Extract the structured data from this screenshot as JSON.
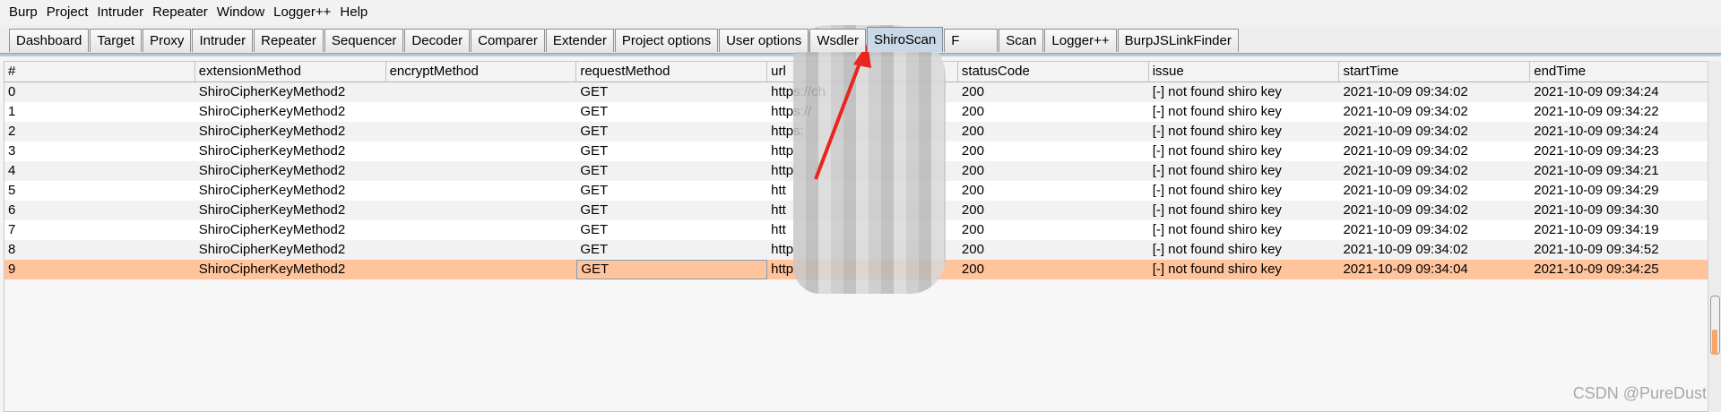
{
  "menu": [
    "Burp",
    "Project",
    "Intruder",
    "Repeater",
    "Window",
    "Logger++",
    "Help"
  ],
  "tabs": [
    "Dashboard",
    "Target",
    "Proxy",
    "Intruder",
    "Repeater",
    "Sequencer",
    "Decoder",
    "Comparer",
    "Extender",
    "Project options",
    "User options",
    "Wsdler",
    "ShiroScan",
    "F",
    "Scan",
    "Logger++",
    "BurpJSLinkFinder"
  ],
  "active_tab": "ShiroScan",
  "columns": [
    "#",
    "extensionMethod",
    "encryptMethod",
    "requestMethod",
    "url",
    "statusCode",
    "issue",
    "startTime",
    "endTime"
  ],
  "rows": [
    {
      "id": "0",
      "ext": "ShiroCipherKeyMethod2",
      "enc": "",
      "req": "GET",
      "url": "https://ch",
      "status": "200",
      "issue": "[-] not found shiro key",
      "start": "2021-10-09 09:34:02",
      "end": "2021-10-09 09:34:24"
    },
    {
      "id": "1",
      "ext": "ShiroCipherKeyMethod2",
      "enc": "",
      "req": "GET",
      "url": "https://",
      "status": "200",
      "issue": "[-] not found shiro key",
      "start": "2021-10-09 09:34:02",
      "end": "2021-10-09 09:34:22"
    },
    {
      "id": "2",
      "ext": "ShiroCipherKeyMethod2",
      "enc": "",
      "req": "GET",
      "url": "https:",
      "status": "200",
      "issue": "[-] not found shiro key",
      "start": "2021-10-09 09:34:02",
      "end": "2021-10-09 09:34:24"
    },
    {
      "id": "3",
      "ext": "ShiroCipherKeyMethod2",
      "enc": "",
      "req": "GET",
      "url": "http",
      "status": "200",
      "issue": "[-] not found shiro key",
      "start": "2021-10-09 09:34:02",
      "end": "2021-10-09 09:34:23"
    },
    {
      "id": "4",
      "ext": "ShiroCipherKeyMethod2",
      "enc": "",
      "req": "GET",
      "url": "http",
      "status": "200",
      "issue": "[-] not found shiro key",
      "start": "2021-10-09 09:34:02",
      "end": "2021-10-09 09:34:21"
    },
    {
      "id": "5",
      "ext": "ShiroCipherKeyMethod2",
      "enc": "",
      "req": "GET",
      "url": "htt",
      "status": "200",
      "issue": "[-] not found shiro key",
      "start": "2021-10-09 09:34:02",
      "end": "2021-10-09 09:34:29"
    },
    {
      "id": "6",
      "ext": "ShiroCipherKeyMethod2",
      "enc": "",
      "req": "GET",
      "url": "htt",
      "status": "200",
      "issue": "[-] not found shiro key",
      "start": "2021-10-09 09:34:02",
      "end": "2021-10-09 09:34:30"
    },
    {
      "id": "7",
      "ext": "ShiroCipherKeyMethod2",
      "enc": "",
      "req": "GET",
      "url": "htt",
      "status": "200",
      "issue": "[-] not found shiro key",
      "start": "2021-10-09 09:34:02",
      "end": "2021-10-09 09:34:19"
    },
    {
      "id": "8",
      "ext": "ShiroCipherKeyMethod2",
      "enc": "",
      "req": "GET",
      "url": "http",
      "status": "200",
      "issue": "[-] not found shiro key",
      "start": "2021-10-09 09:34:02",
      "end": "2021-10-09 09:34:52"
    },
    {
      "id": "9",
      "ext": "ShiroCipherKeyMethod2",
      "enc": "",
      "req": "GET",
      "url": "http",
      "status": "200",
      "issue": "[-] not found shiro key",
      "start": "2021-10-09 09:34:04",
      "end": "2021-10-09 09:34:25"
    }
  ],
  "selected_row": 9,
  "watermark": "CSDN @PureDust",
  "colors": {
    "selected_row": "#ffc49b",
    "active_tab": "#c9d8e6",
    "annotation_arrow": "#e8251f"
  }
}
